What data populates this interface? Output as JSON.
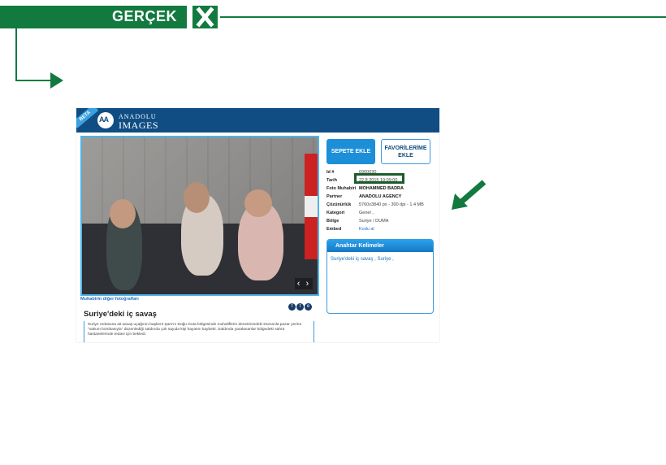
{
  "verdict": {
    "label": "GERÇEK",
    "color": "#127a3f",
    "icon": "close-icon"
  },
  "header": {
    "badge": "BETA",
    "logo_mark": "AA",
    "brand_line1": "ANADOLU",
    "brand_line2": "IMAGES"
  },
  "actions": {
    "add_to_cart": "SEPETE EKLE",
    "add_to_favorites": "FAVORİLERİME EKLE"
  },
  "meta": [
    {
      "key": "Id #",
      "value": "6960030"
    },
    {
      "key": "Tarih",
      "value": "22.8.2015 19:09:00"
    },
    {
      "key": "Foto Muhabiri",
      "value": "MOHAMMED BADRA"
    },
    {
      "key": "Partner",
      "value": "ANADOLU AGENCY"
    },
    {
      "key": "Çözünürlük",
      "value": "5760x3840 px - 300 dpi - 1.4 MB"
    },
    {
      "key": "Kategori",
      "value": "Genel ,"
    },
    {
      "key": "Bölge",
      "value": "Suriye / DUMA"
    },
    {
      "key": "Embed",
      "value": "Kodu al"
    }
  ],
  "keywords": {
    "title": "Anahtar Kelimeler",
    "items": "Suriye'deki iç savaş , Suriye ,"
  },
  "photo_nav": "‹ ›",
  "other_photos_link": "Muhabirin diğer fotoğrafları",
  "social": [
    "f",
    "t",
    "e"
  ],
  "caption_title": "Suriye'deki iç savaş",
  "caption": "Suriye ordusuna ait savaş uçağının başkent Şam'ın Doğu Guta bölgesinde muhaliflerin denetimindeki Duma'da pazar yerine \"vakum bombasıyla\" düzenlediği saldırıda çok sayıda kişi hayatını kaybetti. Saldırıda yaralananlar bölgedeki sahra hastanelerinde tedavi için bekledi."
}
